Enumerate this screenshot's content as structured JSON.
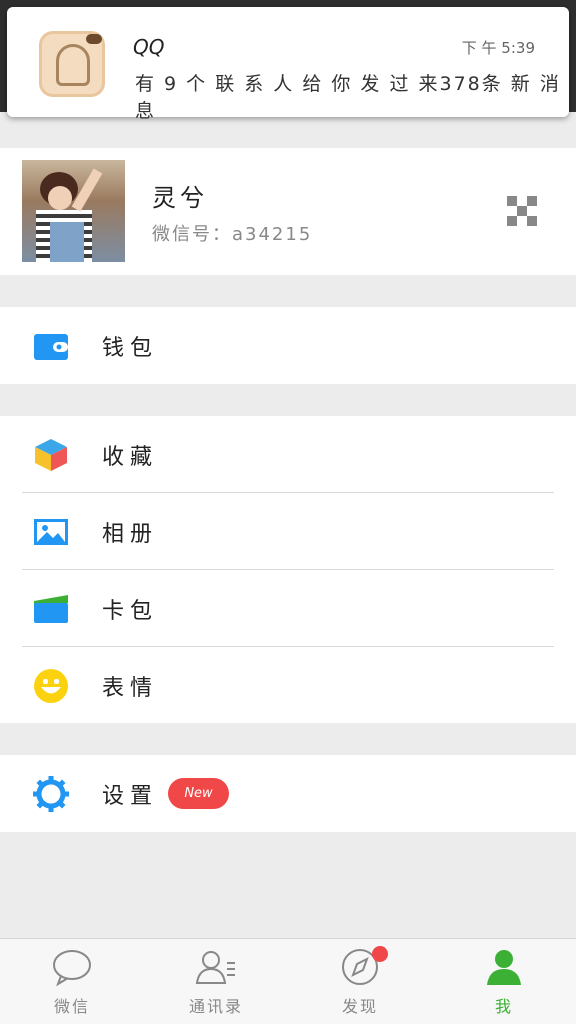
{
  "notification": {
    "app": "QQ",
    "time": "下 午 5:39",
    "message": "有 9 个 联 系 人 给 你 发 过 来378条 新 消 息"
  },
  "profile": {
    "name": "灵兮",
    "wechat_id": "微信号：a34215"
  },
  "menu": {
    "wallet": "钱包",
    "favorites": "收藏",
    "album": "相册",
    "cards": "卡包",
    "stickers": "表情",
    "settings": "设置",
    "settings_badge": "New"
  },
  "tabbar": {
    "items": [
      {
        "label": "微信",
        "icon": "chat-bubble-icon"
      },
      {
        "label": "通讯录",
        "icon": "contacts-icon"
      },
      {
        "label": "发现",
        "icon": "compass-icon"
      },
      {
        "label": "我",
        "icon": "person-icon"
      }
    ],
    "active_color": "#3cb035"
  }
}
